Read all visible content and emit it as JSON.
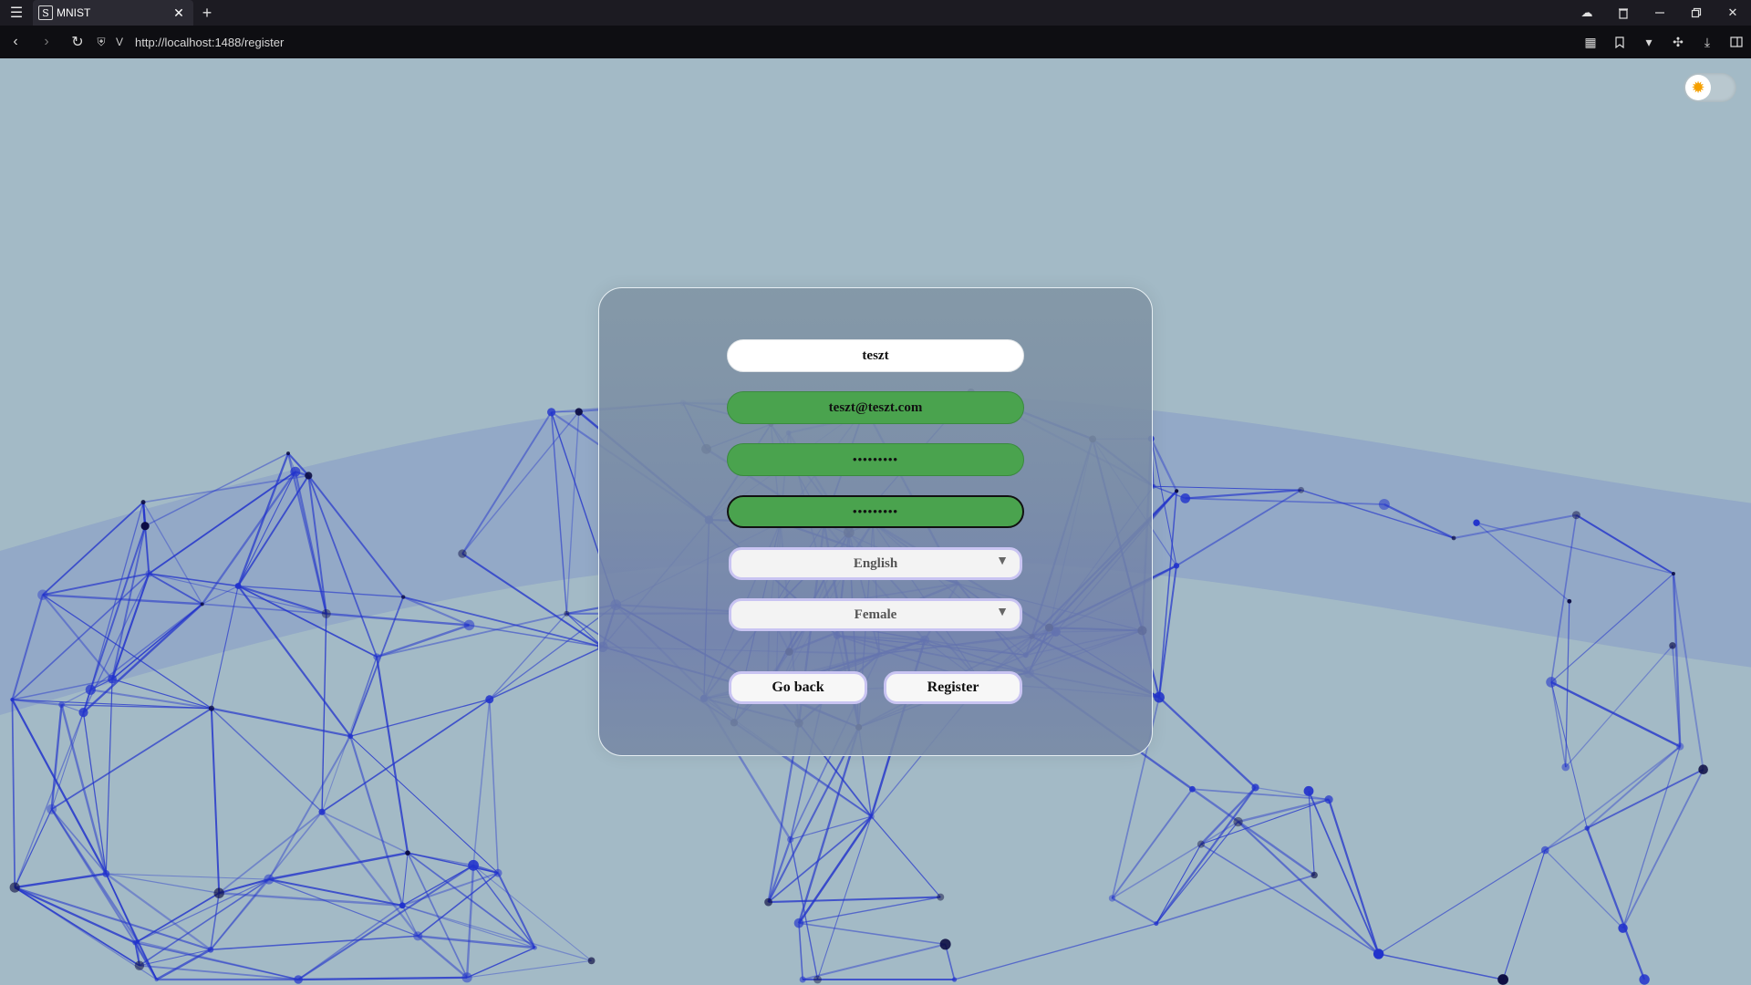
{
  "browser": {
    "tab": {
      "title": "MNIST",
      "favicon": "S"
    },
    "url": "http://localhost:1488/register"
  },
  "icons": {
    "menu": "menu-icon",
    "close": "close-icon",
    "new_tab": "plus-icon",
    "cloud": "cloud-icon",
    "trash": "trash-icon",
    "minimize": "minimize-icon",
    "restore": "restore-icon",
    "window_close": "close-icon",
    "back": "back-arrow-icon",
    "forward": "forward-arrow-icon",
    "reload": "reload-icon",
    "shield": "shield-icon",
    "vpn": "v-icon",
    "qr": "qr-icon",
    "bookmark": "bookmark-icon",
    "dropdown": "chevron-down-icon",
    "extensions": "puzzle-icon",
    "download": "download-icon",
    "sidebar": "sidebar-icon",
    "theme": "sun-icon"
  },
  "form": {
    "username": "teszt",
    "email": "teszt@teszt.com",
    "password": "•••••••••",
    "confirm_password": "•••••••••",
    "language": "English",
    "gender": "Female",
    "back_label": "Go back",
    "register_label": "Register"
  },
  "colors": {
    "valid_field": "#4aa34e",
    "background": "#a3bac6",
    "network": "#2233cc",
    "select_border": "#c9c4f2"
  }
}
